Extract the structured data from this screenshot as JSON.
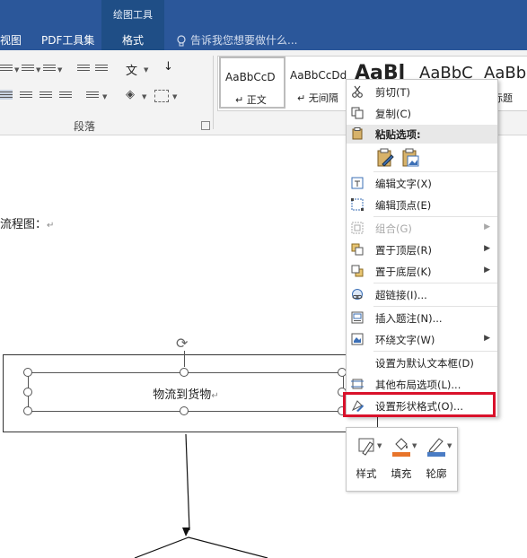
{
  "tabs": {
    "view": "视图",
    "pdf": "PDF工具集",
    "context_group": "绘图工具",
    "format": "格式",
    "tell_me": "告诉我您想要做什么..."
  },
  "ribbon": {
    "paragraph_group": "段落",
    "styles": [
      {
        "sample": "AaBbCcD",
        "name": "↵ 正文"
      },
      {
        "sample": "AaBbCcDd",
        "name": "↵ 无间隔"
      },
      {
        "sample": "AaBl",
        "name": ""
      },
      {
        "sample": "AaBbC",
        "name": ""
      },
      {
        "sample": "AaBb",
        "name": "标题"
      }
    ]
  },
  "document": {
    "intro_text": "流程图：",
    "shape_text": "物流到货物",
    "para_mark": "↵"
  },
  "context_menu": {
    "cut": "剪切(T)",
    "copy": "复制(C)",
    "paste_options": "粘贴选项:",
    "edit_text": "编辑文字(X)",
    "edit_points": "编辑顶点(E)",
    "group": "组合(G)",
    "bring_front": "置于顶层(R)",
    "send_back": "置于底层(K)",
    "hyperlink": "超链接(I)...",
    "insert_caption": "插入题注(N)...",
    "wrap_text": "环绕文字(W)",
    "set_default": "设置为默认文本框(D)",
    "more_layout": "其他布局选项(L)...",
    "format_shape": "设置形状格式(O)..."
  },
  "mini_toolbar": {
    "style": "样式",
    "fill": "填充",
    "outline": "轮廓"
  },
  "colors": {
    "ribbon_blue": "#2b579a",
    "highlight_red": "#d9112b",
    "fill_orange": "#e8742a",
    "outline_blue": "#4a7cc4"
  }
}
